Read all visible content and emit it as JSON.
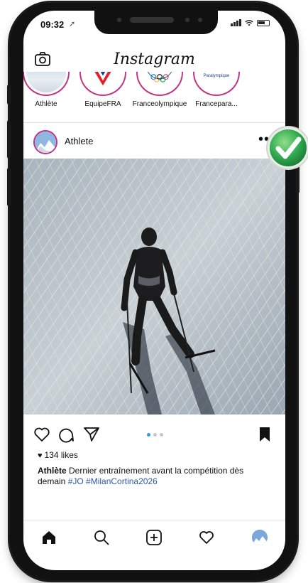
{
  "status_bar": {
    "time": "09:32",
    "location_icon": "location-arrow-icon"
  },
  "header": {
    "app_title": "Instagram",
    "camera_icon": "camera-icon"
  },
  "stories": [
    {
      "label": "Athlète"
    },
    {
      "label": "EquipeFRA"
    },
    {
      "label": "Franceolympique"
    },
    {
      "label": "Francepara..."
    }
  ],
  "story_texts": {
    "france_paralympique": "France Paralympique"
  },
  "post": {
    "username": "Athlete",
    "more_icon": "•••",
    "likes": "134 likes",
    "caption_user": "Athlète",
    "caption_text": "Dernier entraînement avant la compétition dès demain",
    "caption_tags": "#JO #MilanCortina2026",
    "carousel": {
      "count": 3,
      "active": 1
    }
  },
  "tabbar": {
    "items": [
      "home-icon",
      "search-icon",
      "add-post-icon",
      "activity-heart-icon",
      "profile-avatar"
    ]
  },
  "colors": {
    "story_ring": "#c13584",
    "carousel_active": "#3897f0",
    "hashtag": "#2b5aa8",
    "check_green": "#2fa84f"
  }
}
